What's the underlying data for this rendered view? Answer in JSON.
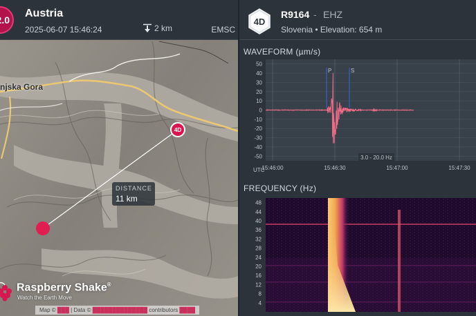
{
  "event": {
    "magnitude": "2.0",
    "region": "Austria",
    "datetime": "2025-06-07 15:46:24",
    "depth": "2 km",
    "source": "EMSC",
    "place_label": "njska Gora",
    "distance_label": "DISTANCE",
    "distance_value": "11 km",
    "colors": {
      "accent": "#d8164f",
      "badge": "#b3124a"
    }
  },
  "station_pin": {
    "label": "4D"
  },
  "branding": {
    "name": "Raspberry Shake",
    "trademark": "®",
    "tagline": "Watch the Earth Move",
    "icon": "raspberry-shake-logo-icon"
  },
  "attribution": {
    "map_prefix": "Map ©",
    "data_prefix": "| Data ©",
    "contributors": "contributors"
  },
  "station": {
    "badge": "4D",
    "code": "R9164",
    "separator": "-",
    "channel": "EHZ",
    "location": "Slovenia • Elevation: 654 m"
  },
  "waveform": {
    "title": "WAVEFORM",
    "unit": "(µm/s)",
    "p_label": "P",
    "s_label": "S",
    "filter": "3.0 - 20.0 Hz",
    "utc_label": "UTC",
    "color": "#f06c86"
  },
  "chart_data": [
    {
      "type": "line",
      "title": "WAVEFORM (µm/s)",
      "y_ticks": [
        50,
        40,
        30,
        20,
        10,
        0,
        -10,
        -20,
        -30,
        -40,
        -50
      ],
      "x_ticks": [
        "15:46:00",
        "15:46:30",
        "15:47:00",
        "15:47:30"
      ],
      "ylim": [
        -55,
        55
      ],
      "series_note": "",
      "series": [
        {
          "name": "",
          "x_seconds_marks": {
            "P": 26,
            "S": 37
          },
          "values": [
            [
              0,
              0
            ],
            [
              26,
              0
            ],
            [
              26.5,
              3
            ],
            [
              27,
              -4
            ],
            [
              27.5,
              5
            ],
            [
              28,
              -6
            ],
            [
              28.5,
              22
            ],
            [
              29,
              -35
            ],
            [
              29.3,
              50
            ],
            [
              29.6,
              -55
            ],
            [
              30,
              42
            ],
            [
              30.3,
              -38
            ],
            [
              30.6,
              28
            ],
            [
              31,
              -25
            ],
            [
              31.5,
              14
            ],
            [
              32,
              -12
            ],
            [
              32.5,
              8
            ],
            [
              33,
              -6
            ],
            [
              34,
              4
            ],
            [
              35,
              -3
            ],
            [
              36,
              2
            ],
            [
              38,
              -1.5
            ],
            [
              40,
              1
            ],
            [
              45,
              0
            ],
            [
              48,
              0
            ],
            [
              49,
              1.5
            ],
            [
              49.5,
              -2
            ],
            [
              50,
              1
            ],
            [
              51,
              0
            ],
            [
              68,
              0
            ]
          ]
        }
      ],
      "grid": true
    },
    {
      "type": "heatmap",
      "title": "FREQUENCY (Hz)",
      "y_ticks": [
        48,
        44,
        40,
        36,
        32,
        28,
        24,
        20,
        16,
        12,
        8,
        4
      ],
      "ylim": [
        0,
        50
      ],
      "colormap": "magma",
      "features": {
        "event_onset_seconds": 26,
        "secondary_band_seconds": 49,
        "constant_noise_line_hz": 38
      }
    }
  ],
  "frequency": {
    "title": "FREQUENCY",
    "unit": "(Hz)"
  }
}
